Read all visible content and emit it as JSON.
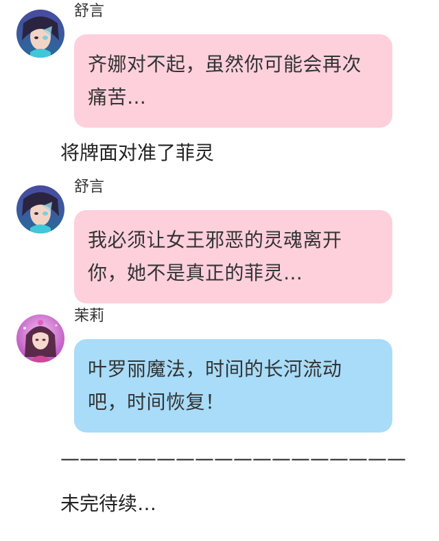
{
  "messages": [
    {
      "sender": "舒言",
      "avatar_icon": "shuyan-avatar-icon",
      "bubble_color": "#fdd0db",
      "text": "齐娜对不起，虽然你可能会再次痛苦…"
    },
    {
      "sender": "舒言",
      "avatar_icon": "shuyan-avatar-icon",
      "bubble_color": "#fdd0db",
      "text": "我必须让女王邪恶的灵魂离开你，她不是真正的菲灵…"
    },
    {
      "sender": "茉莉",
      "avatar_icon": "moli-avatar-icon",
      "bubble_color": "#a8dcf8",
      "text": "叶罗丽魔法，时间的长河流动吧，时间恢复！"
    }
  ],
  "narration_1": "将牌面对准了菲灵",
  "divider": "——————————————————",
  "ending": "未完待续…"
}
